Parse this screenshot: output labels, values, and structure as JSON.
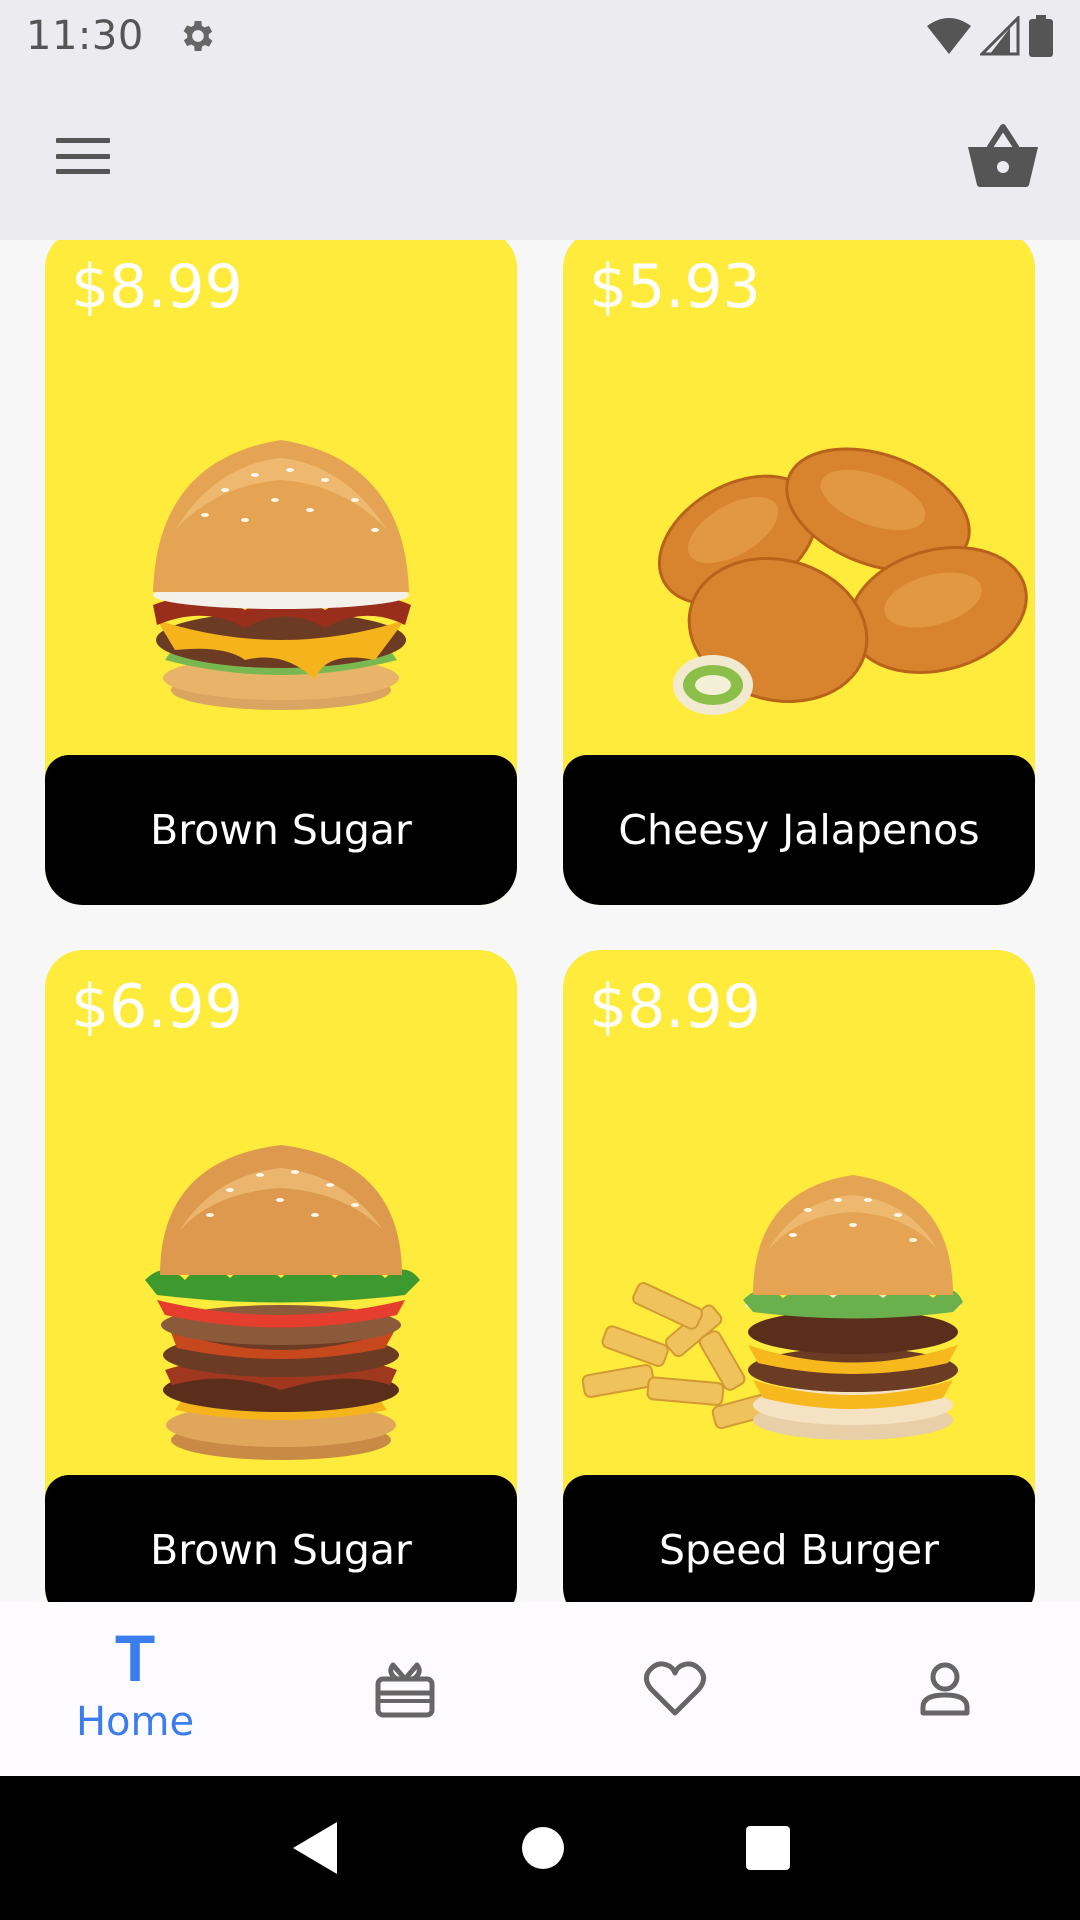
{
  "status_bar": {
    "time": "11:30",
    "icons": [
      "settings-icon",
      "wifi-icon",
      "cellular-icon",
      "battery-icon"
    ]
  },
  "app_bar": {
    "icons": [
      "menu-icon",
      "basket-icon"
    ]
  },
  "products": [
    {
      "price": "$8.99",
      "name": "Brown Sugar",
      "image": "bacon-cheeseburger"
    },
    {
      "price": "$5.93",
      "name": "Cheesy Jalapenos",
      "image": "breaded-jalapeno-poppers"
    },
    {
      "price": "$6.99",
      "name": "Brown Sugar",
      "image": "stacked-double-burger"
    },
    {
      "price": "$8.99",
      "name": "Speed Burger",
      "image": "double-cheeseburger-with-fries"
    }
  ],
  "bottom_nav": {
    "home": {
      "glyph": "T",
      "label": "Home",
      "active": true
    },
    "items": [
      "gift-icon",
      "heart-icon",
      "profile-icon"
    ]
  },
  "colors": {
    "card_background": "#ffeb3b",
    "label_bar": "#000000",
    "active_nav": "#3b7ded",
    "top_bar": "#ebebf0"
  }
}
